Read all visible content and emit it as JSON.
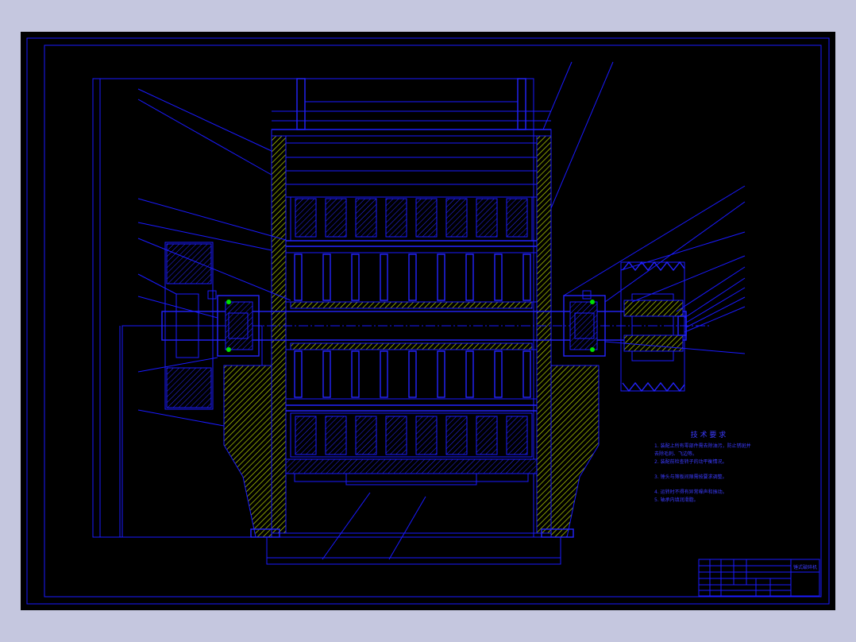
{
  "drawing": {
    "notes_title": "技 术 要 求",
    "notes": [
      "1. 装配上所有零部件需去除油污，防止锈斑并",
      "   去除毛刺、飞边等。",
      "2. 装配前检查转子的动平衡情况。",
      "3. 锤头与筛板间隙需按要求调整。",
      "4. 运转时不得有异常噪声和振动。",
      "5. 轴承内填润滑脂。"
    ],
    "title_block": {
      "name": "锤式破碎机",
      "rows": [
        "",
        "",
        "",
        ""
      ]
    },
    "colors": {
      "background": "#000000",
      "frame": "#c5c7df",
      "line": "#1a1aff",
      "hatch": "#b8d400",
      "accent_green": "#00e000"
    }
  }
}
